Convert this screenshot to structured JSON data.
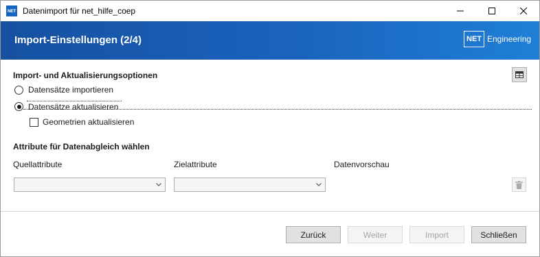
{
  "window": {
    "title": "Datenimport für net_hilfe_coep",
    "app_icon_text": "NET"
  },
  "header": {
    "title": "Import-Einstellungen (2/4)",
    "logo_box": "NET",
    "logo_text": "Engineering",
    "gradient_start": "#1650a0",
    "gradient_end": "#1f7fd6"
  },
  "options": {
    "section_title": "Import- und Aktualisierungsoptionen",
    "radio_import": {
      "label": "Datensätze importieren",
      "checked": false
    },
    "radio_update": {
      "label": "Datensätze aktualisieren",
      "checked": true
    },
    "checkbox_geometry": {
      "label": "Geometrien aktualisieren",
      "checked": false
    },
    "view_button_icon": "table-icon"
  },
  "attributes": {
    "section_title": "Attribute für Datenabgleich wählen",
    "col_source": "Quellattribute",
    "col_target": "Zielattribute",
    "col_preview": "Datenvorschau",
    "source_value": "",
    "target_value": "",
    "delete_icon": "trash-icon"
  },
  "footer": {
    "back": "Zurück",
    "next": "Weiter",
    "import": "Import",
    "close": "Schließen"
  }
}
